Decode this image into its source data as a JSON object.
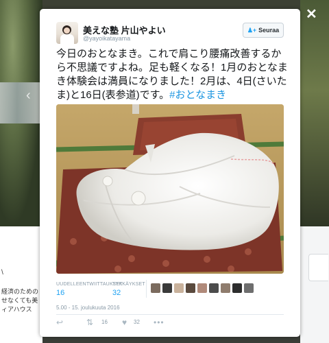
{
  "overlay": {
    "prev_arrow": "‹",
    "close_glyph": "✕",
    "colors": {
      "backdrop": "#3c4034",
      "link": "#1b95e0",
      "accent": "#1da1f2"
    }
  },
  "background_card": {
    "lines": [
      "経済のための",
      "せなくても美",
      "ィアハウス"
    ]
  },
  "author": {
    "display_name": "美えな塾 片山やよい",
    "handle": "@yayoikatayama",
    "avatar_icon": "profile-photo"
  },
  "follow_button": {
    "icon": "add-user-icon",
    "label": "Seuraa"
  },
  "tweet": {
    "text": "今日のおとなまき。これで肩こり腰痛改善するから不思議ですよね。足も軽くなる！1月のおとなまき体験会は満員になりました！2月は、4日(さいたま)と16日(表参道)です。",
    "hashtag": "#おとなまき"
  },
  "stats": {
    "retweets_label": "UUDELLEENTWIITTAUKSET",
    "retweets_value": "16",
    "likes_label": "TYKKÄYKSET",
    "likes_value": "32"
  },
  "likers": [
    "#7b6b5e",
    "#3a3a3a",
    "#c9b29c",
    "#5a4a3e",
    "#b08a7a",
    "#4c4c4c",
    "#8f7c6d",
    "#2d2d2d",
    "#6e6e6e"
  ],
  "timestamp": "5.00 - 15. joulukuuta 2016",
  "actions": {
    "reply_icon": "reply-icon",
    "retweet_icon": "retweet-icon",
    "retweet_count": "16",
    "like_icon": "heart-icon",
    "like_count": "32",
    "more_icon": "more-icon"
  }
}
